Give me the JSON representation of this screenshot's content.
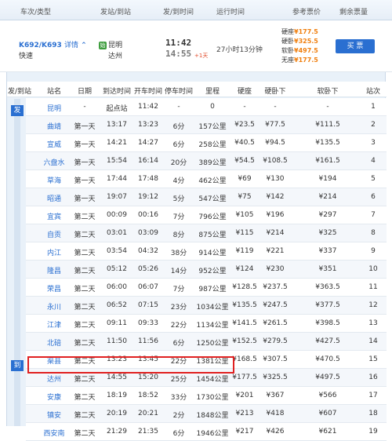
{
  "header": {
    "cols": [
      "车次/类型",
      "发站/到站",
      "发/到时间",
      "运行时间",
      "参考票价",
      "剩余票量"
    ]
  },
  "train": {
    "number": "K692/K693",
    "detail_label": "详情",
    "type": "快速",
    "from": "昆明",
    "to": "达州",
    "depart": "11:42",
    "arrive": "14:55",
    "plus_day": "+1天",
    "duration": "27小时13分钟",
    "prices": [
      {
        "label": "硬座",
        "value": "¥177.5"
      },
      {
        "label": "硬卧",
        "value": "¥325.5"
      },
      {
        "label": "软卧",
        "value": "¥497.5"
      },
      {
        "label": "无座",
        "value": "¥177.5"
      }
    ],
    "buy_label": "买 票"
  },
  "table": {
    "side_start": "发",
    "side_end": "到",
    "cols": [
      "发/到站",
      "站名",
      "日期",
      "到达时间",
      "开车时间",
      "停车时间",
      "里程",
      "硬座",
      "硬卧下",
      "软卧下",
      "站次"
    ],
    "rows": [
      [
        "昆明",
        "-",
        "起点站",
        "11:42",
        "-",
        "0",
        "-",
        "-",
        "-",
        "1"
      ],
      [
        "曲靖",
        "第一天",
        "13:17",
        "13:23",
        "6分",
        "157公里",
        "¥23.5",
        "¥77.5",
        "¥111.5",
        "2"
      ],
      [
        "宣威",
        "第一天",
        "14:21",
        "14:27",
        "6分",
        "258公里",
        "¥40.5",
        "¥94.5",
        "¥135.5",
        "3"
      ],
      [
        "六盘水",
        "第一天",
        "15:54",
        "16:14",
        "20分",
        "389公里",
        "¥54.5",
        "¥108.5",
        "¥161.5",
        "4"
      ],
      [
        "草海",
        "第一天",
        "17:44",
        "17:48",
        "4分",
        "462公里",
        "¥69",
        "¥130",
        "¥194",
        "5"
      ],
      [
        "昭通",
        "第一天",
        "19:07",
        "19:12",
        "5分",
        "547公里",
        "¥75",
        "¥142",
        "¥214",
        "6"
      ],
      [
        "宜宾",
        "第二天",
        "00:09",
        "00:16",
        "7分",
        "796公里",
        "¥105",
        "¥196",
        "¥297",
        "7"
      ],
      [
        "自贡",
        "第二天",
        "03:01",
        "03:09",
        "8分",
        "875公里",
        "¥115",
        "¥214",
        "¥325",
        "8"
      ],
      [
        "内江",
        "第二天",
        "03:54",
        "04:32",
        "38分",
        "914公里",
        "¥119",
        "¥221",
        "¥337",
        "9"
      ],
      [
        "隆昌",
        "第二天",
        "05:12",
        "05:26",
        "14分",
        "952公里",
        "¥124",
        "¥230",
        "¥351",
        "10"
      ],
      [
        "荣昌",
        "第二天",
        "06:00",
        "06:07",
        "7分",
        "987公里",
        "¥128.5",
        "¥237.5",
        "¥363.5",
        "11"
      ],
      [
        "永川",
        "第二天",
        "06:52",
        "07:15",
        "23分",
        "1034公里",
        "¥135.5",
        "¥247.5",
        "¥377.5",
        "12"
      ],
      [
        "江津",
        "第二天",
        "09:11",
        "09:33",
        "22分",
        "1134公里",
        "¥141.5",
        "¥261.5",
        "¥398.5",
        "13"
      ],
      [
        "北碚",
        "第二天",
        "11:50",
        "11:56",
        "6分",
        "1250公里",
        "¥152.5",
        "¥279.5",
        "¥427.5",
        "14"
      ],
      [
        "渠县",
        "第二天",
        "13:23",
        "13:45",
        "22分",
        "1381公里",
        "¥168.5",
        "¥307.5",
        "¥470.5",
        "15"
      ],
      [
        "达州",
        "第二天",
        "14:55",
        "15:20",
        "25分",
        "1454公里",
        "¥177.5",
        "¥325.5",
        "¥497.5",
        "16"
      ],
      [
        "安康",
        "第二天",
        "18:19",
        "18:52",
        "33分",
        "1730公里",
        "¥201",
        "¥367",
        "¥566",
        "17"
      ],
      [
        "镇安",
        "第二天",
        "20:19",
        "20:21",
        "2分",
        "1848公里",
        "¥213",
        "¥418",
        "¥607",
        "18"
      ],
      [
        "西安南",
        "第二天",
        "21:29",
        "21:35",
        "6分",
        "1946公里",
        "¥217",
        "¥426",
        "¥621",
        "19"
      ]
    ]
  }
}
